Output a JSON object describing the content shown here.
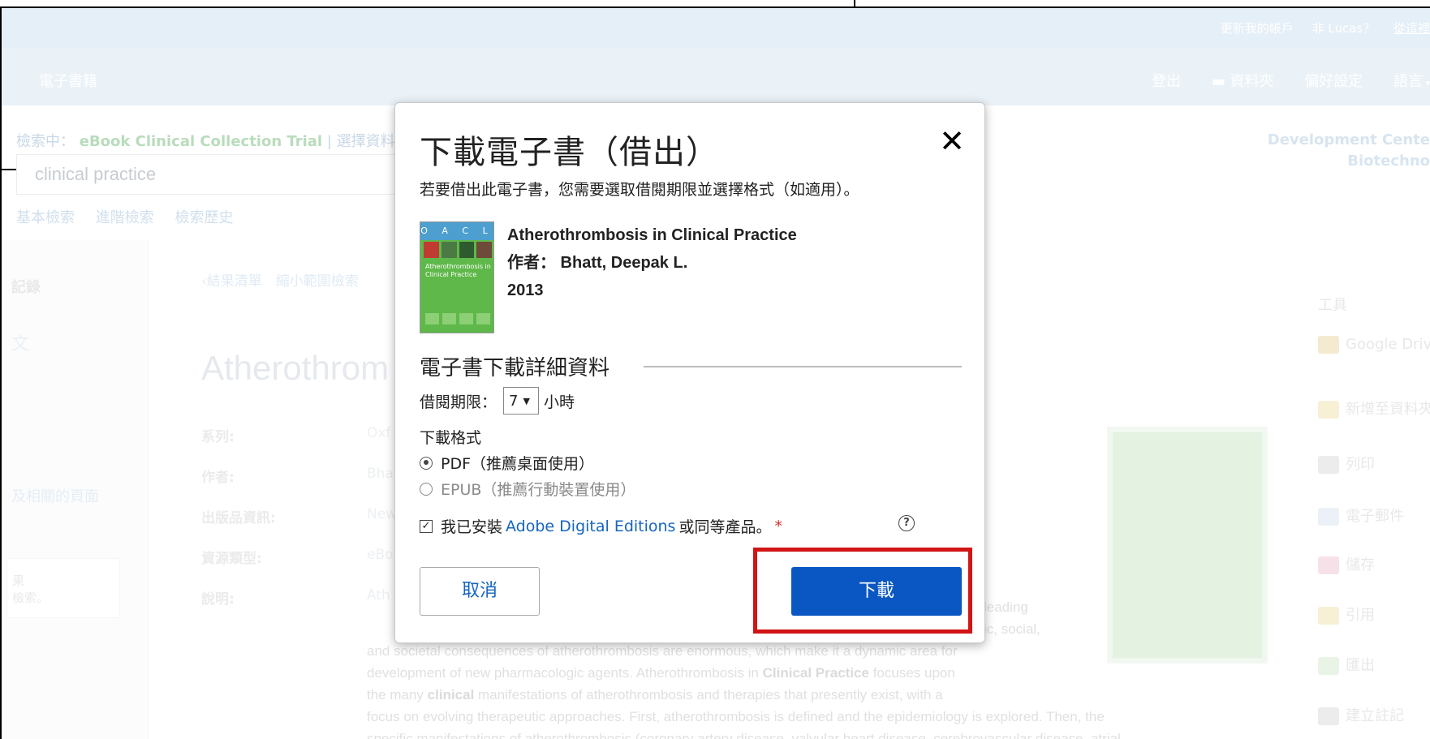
{
  "topbar": {
    "links": [
      "更新我的帳戶",
      "非 Lucas？",
      "從這裡"
    ]
  },
  "nav": {
    "brand": "電子書籍",
    "items": [
      "登出",
      "資料夾",
      "偏好設定",
      "語言"
    ]
  },
  "search": {
    "scope_prefix": "檢索中：",
    "scope_name": "eBook Clinical Collection Trial",
    "scope_link": "選擇資料",
    "query": "clinical practice",
    "links": [
      "基本檢索",
      "進階檢索",
      "檢索歷史"
    ]
  },
  "org": {
    "line1": "Development Cente",
    "line2": "Biotechno"
  },
  "leftpanel": {
    "heading": "記錄",
    "item": "文",
    "related": "及相關的頁面",
    "box_title": "果",
    "box_text": "檢索。"
  },
  "crumbs": "‹結果清單　縮小範圍檢索",
  "record": {
    "title": "Atherothrom",
    "labels": [
      "系列:",
      "作者:",
      "出版品資訊:",
      "資源類型:",
      "說明:"
    ],
    "values": [
      "Oxf",
      "Bha",
      "New",
      "eBo",
      "Ath"
    ],
    "desc_lines": [
      "leading",
      "ic, social,",
      "and societal consequences of atherothrombosis are enormous, which make it a dynamic area for",
      "development of new pharmacologic agents. Atherothrombosis in",
      "focuses upon",
      "the many",
      "manifestations of atherothrombosis and therapies that presently exist, with a",
      "focus on evolving therapeutic approaches. First, atherothrombosis is defined and the epidemiology is explored. Then, the",
      "specific manifestations of atherothrombosis (coronary artery disease, valvular heart disease, cerebrovascular disease, atrial"
    ],
    "desc_bold": [
      "Clinical Practice",
      "clinical"
    ]
  },
  "tools": {
    "heading": "工具",
    "items": [
      "Google Drive",
      "新增至資料夾",
      "列印",
      "電子郵件",
      "儲存",
      "引用",
      "匯出",
      "建立註記"
    ]
  },
  "modal": {
    "title": "下載電子書（借出）",
    "close": "✕",
    "subtitle": "若要借出此電子書，您需要選取借閱期限並選擇格式（如適用）。",
    "book_title": "Atherothrombosis in Clinical Practice",
    "book_author": "作者： Bhatt, Deepak L.",
    "book_year": "2013",
    "cover_band": "O A C L",
    "cover_text": "Atherothrombosis in Clinical Practice",
    "section": "電子書下載詳細資料",
    "loan_label": "借閱期限：",
    "loan_value": "7",
    "loan_unit": "小時",
    "format_label": "下載格式",
    "format_pdf": "PDF（推薦桌面使用）",
    "format_epub": "EPUB（推薦行動裝置使用）",
    "agree_prefix": "我已安裝",
    "agree_link": "Adobe Digital Editions",
    "agree_suffix": "或同等產品。",
    "agree_required": "*",
    "help": "?",
    "cancel": "取消",
    "download": "下載"
  },
  "colors": {
    "download_button": "#0a57c4",
    "highlight_border": "#d11414",
    "link": "#1565c0"
  }
}
